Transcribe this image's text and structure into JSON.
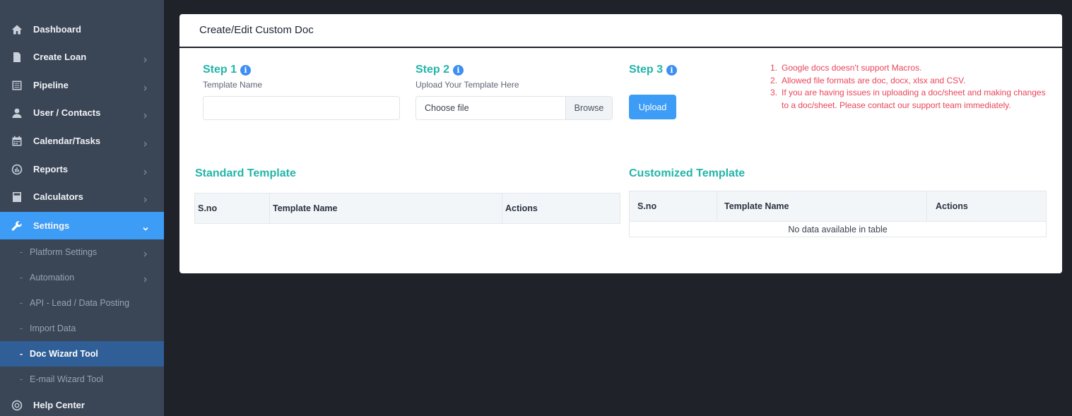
{
  "sidebar": {
    "items": [
      {
        "label": "Dashboard",
        "icon": "home-icon"
      },
      {
        "label": "Create Loan",
        "icon": "document-icon"
      },
      {
        "label": "Pipeline",
        "icon": "list-icon"
      },
      {
        "label": "User / Contacts",
        "icon": "user-icon"
      },
      {
        "label": "Calendar/Tasks",
        "icon": "calendar-icon"
      },
      {
        "label": "Reports",
        "icon": "chart-icon"
      },
      {
        "label": "Calculators",
        "icon": "calculator-icon"
      },
      {
        "label": "Settings",
        "icon": "wrench-icon"
      }
    ],
    "settings_sub": [
      {
        "label": "Platform Settings"
      },
      {
        "label": "Automation"
      },
      {
        "label": "API - Lead / Data Posting"
      },
      {
        "label": "Import Data"
      },
      {
        "label": "Doc Wizard Tool"
      },
      {
        "label": "E-mail Wizard Tool"
      }
    ],
    "help": {
      "label": "Help Center",
      "icon": "lifebuoy-icon"
    }
  },
  "page": {
    "title": "Create/Edit Custom Doc"
  },
  "steps": {
    "step1": {
      "title": "Step 1",
      "sub": "Template Name",
      "value": "",
      "placeholder": ""
    },
    "step2": {
      "title": "Step 2",
      "sub": "Upload Your Template Here",
      "file_label": "Choose file",
      "browse_label": "Browse"
    },
    "step3": {
      "title": "Step 3",
      "upload_label": "Upload"
    }
  },
  "notes": [
    {
      "num": "1.",
      "text": "Google docs doesn't support Macros."
    },
    {
      "num": "2.",
      "text": "Allowed file formats are doc, docx, xlsx and CSV."
    },
    {
      "num": "3.",
      "text": "If you are having issues in uploading a doc/sheet and making changes to a doc/sheet. Please contact our support team immediately."
    }
  ],
  "standard_template": {
    "title": "Standard Template",
    "columns": [
      "S.no",
      "Template Name",
      "Actions"
    ]
  },
  "customized_template": {
    "title": "Customized Template",
    "columns": [
      "S.no",
      "Template Name",
      "Actions"
    ],
    "empty_message": "No data available in table"
  },
  "colors": {
    "accent": "#3d9cf5",
    "teal": "#22b5a8",
    "note_red": "#e8455a",
    "sidebar_bg": "#3a4556"
  }
}
